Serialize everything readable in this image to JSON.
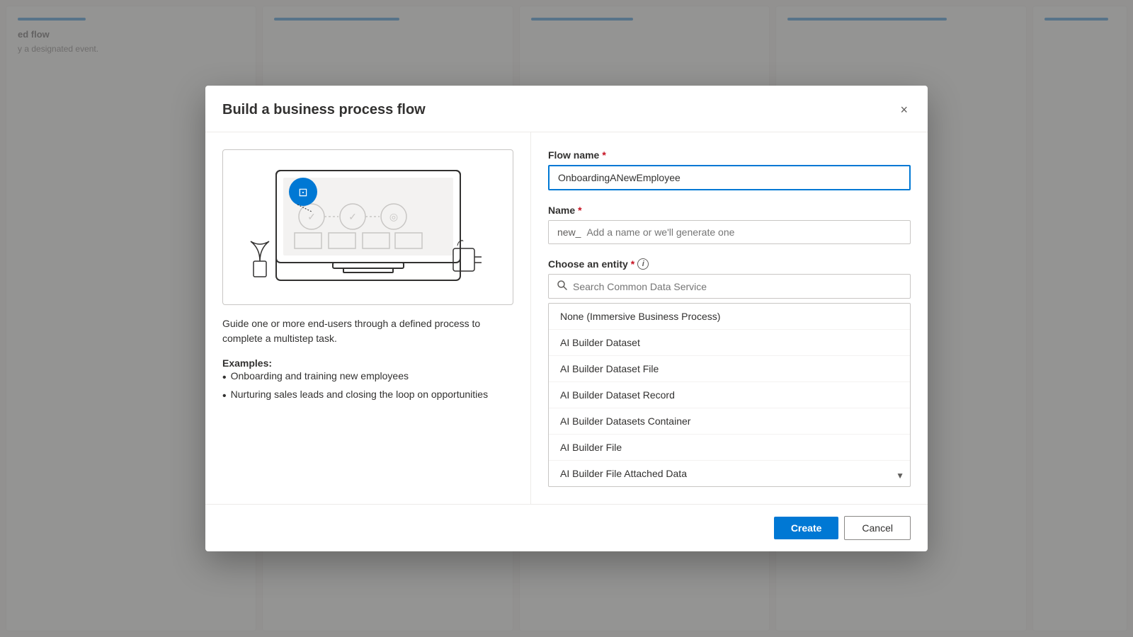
{
  "dialog": {
    "title": "Build a business process flow",
    "close_label": "×"
  },
  "illustration": {
    "alt": "Business process flow illustration"
  },
  "description": {
    "main": "Guide one or more end-users through a defined process to complete a multistep task.",
    "examples_title": "Examples:",
    "examples": [
      "Onboarding and training new employees",
      "Nurturing sales leads and closing the loop on opportunities"
    ]
  },
  "form": {
    "flow_name_label": "Flow name",
    "flow_name_value": "OnboardingANewEmployee",
    "name_label": "Name",
    "name_prefix": "new_",
    "name_placeholder": "Add a name or we'll generate one",
    "entity_label": "Choose an entity",
    "search_placeholder": "Search Common Data Service",
    "entities": [
      "None (Immersive Business Process)",
      "AI Builder Dataset",
      "AI Builder Dataset File",
      "AI Builder Dataset Record",
      "AI Builder Datasets Container",
      "AI Builder File",
      "AI Builder File Attached Data"
    ]
  },
  "footer": {
    "create_label": "Create",
    "cancel_label": "Cancel"
  },
  "icons": {
    "close": "✕",
    "search": "🔍",
    "info": "i",
    "chevron_down": "▼"
  }
}
